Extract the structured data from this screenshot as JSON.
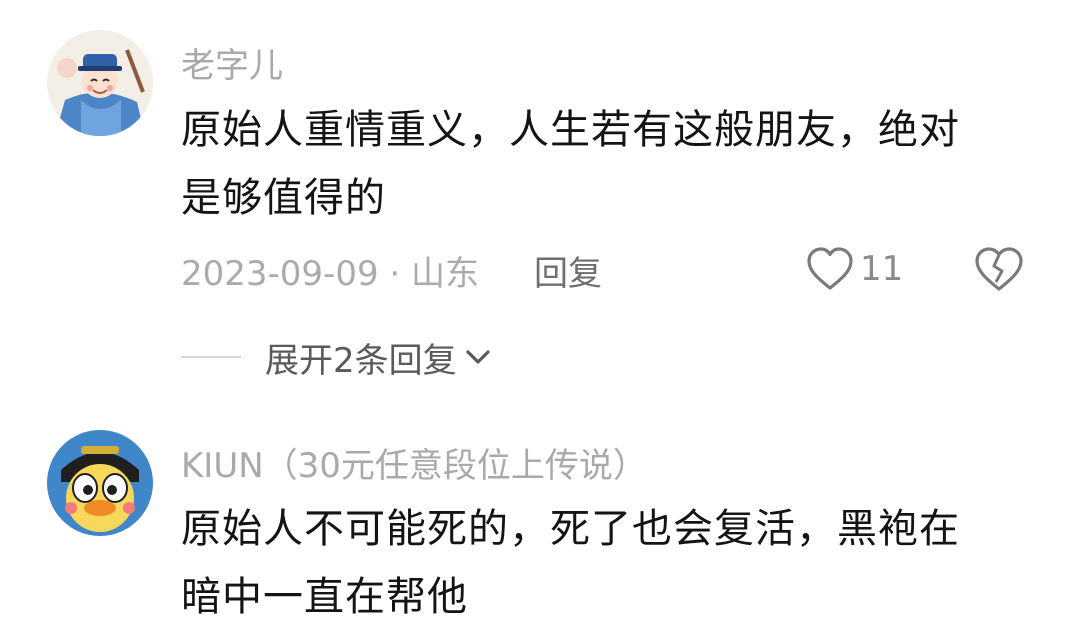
{
  "comments": [
    {
      "username": "老字儿",
      "text_lines": [
        "原始人重情重义，人生若有这般朋友，绝对",
        "是够值得的"
      ],
      "meta": "2023-09-09 · 山东",
      "reply_label": "回复",
      "likes": "11",
      "expand_label": "展开2条回复"
    },
    {
      "username": "KIUN（30元任意段位上传说）",
      "text_lines": [
        "原始人不可能死的，死了也会复活，黑袍在",
        "暗中一直在帮他"
      ]
    }
  ],
  "icons": {
    "like": "heart-outline-icon",
    "dislike": "broken-heart-icon",
    "expand": "chevron-down-icon"
  },
  "colors": {
    "username": "#a9a9a9",
    "text": "#141414",
    "meta": "#ababab",
    "reply": "#6e6e6e"
  }
}
